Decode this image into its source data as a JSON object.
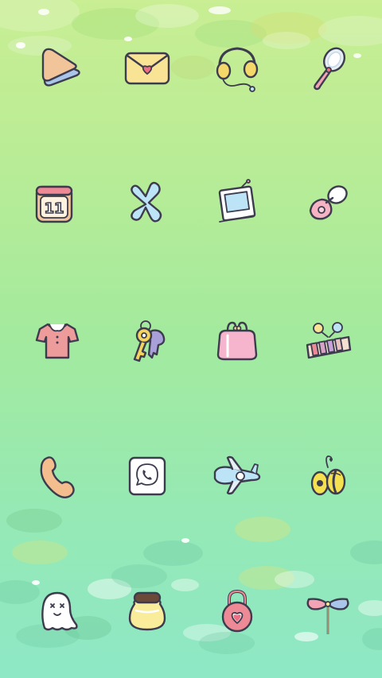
{
  "screen": {
    "name": "home-screen"
  },
  "apps": [
    {
      "id": "app-1",
      "icon": "play-triangle-icon",
      "color": "#f5c7a0"
    },
    {
      "id": "app-2",
      "icon": "envelope-heart-icon",
      "color": "#f9e394"
    },
    {
      "id": "app-3",
      "icon": "headphones-icon",
      "color": "#f5d86a"
    },
    {
      "id": "app-4",
      "icon": "hand-mirror-icon",
      "color": "#f4a3b5"
    },
    {
      "id": "app-5",
      "icon": "calendar-11-icon",
      "color": "#f2c49a",
      "label_text": "11"
    },
    {
      "id": "app-6",
      "icon": "bluetooth-icon",
      "color": "#bde3f7"
    },
    {
      "id": "app-7",
      "icon": "photo-frame-icon",
      "color": "#bde3f7"
    },
    {
      "id": "app-8",
      "icon": "pacifier-icon",
      "color": "#f5b3c4"
    },
    {
      "id": "app-9",
      "icon": "shirt-icon",
      "color": "#ee9b9b"
    },
    {
      "id": "app-10",
      "icon": "keys-icon",
      "color": "#f4d35e"
    },
    {
      "id": "app-11",
      "icon": "coin-purse-icon",
      "color": "#f6b5cc"
    },
    {
      "id": "app-12",
      "icon": "xylophone-icon",
      "color": "#e8c2c2"
    },
    {
      "id": "app-13",
      "icon": "phone-handset-icon",
      "color": "#f3bd8d"
    },
    {
      "id": "app-14",
      "icon": "chat-phone-icon",
      "color": "#ffffff"
    },
    {
      "id": "app-15",
      "icon": "airplane-icon",
      "color": "#bde3f7"
    },
    {
      "id": "app-16",
      "icon": "bee-icon",
      "color": "#f5e04f"
    },
    {
      "id": "app-17",
      "icon": "ghost-icon",
      "color": "#ffffff"
    },
    {
      "id": "app-18",
      "icon": "honey-jar-icon",
      "color": "#f9ec9a"
    },
    {
      "id": "app-19",
      "icon": "heart-padlock-icon",
      "color": "#ee8a95"
    },
    {
      "id": "app-20",
      "icon": "pinwheel-icon",
      "color": "#f4a3b5"
    }
  ]
}
